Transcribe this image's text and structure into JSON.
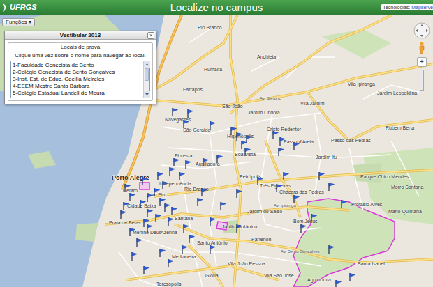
{
  "header": {
    "logo": "UFRGS",
    "title": "Localize no campus",
    "tech_label": "Tecnologias:",
    "tech_link": "Mapserve"
  },
  "functions_button": {
    "label": "Funções",
    "icon": "▾"
  },
  "panel": {
    "title": "Vestibular 2013",
    "close": "×",
    "section": "Locais de prova",
    "hint": "Clique uma vez sobre o nome para navegar ao local.",
    "items": [
      {
        "label": "1-Faculdade Cenecista de Bento",
        "selected": false
      },
      {
        "label": "2-Colégio Cenecista de Bento Gonçalves",
        "selected": false
      },
      {
        "label": "3-Inst. Est. de Educ. Cecília Meireles",
        "selected": false
      },
      {
        "label": "4-EEEM Mestre Santa Bárbara",
        "selected": false
      },
      {
        "label": "5-Colégio Estadual Landell de Moura",
        "selected": false
      }
    ]
  },
  "map": {
    "places": [
      {
        "name": "Rio Branco",
        "kind": "district"
      },
      {
        "name": "Anchieta",
        "kind": "district"
      },
      {
        "name": "Humaitá",
        "kind": "district"
      },
      {
        "name": "Farrapos",
        "kind": "district"
      },
      {
        "name": "São João",
        "kind": "district"
      },
      {
        "name": "Vila Ipiranga",
        "kind": "district"
      },
      {
        "name": "Vila Jardim",
        "kind": "district"
      },
      {
        "name": "Jardim Lindóia",
        "kind": "district"
      },
      {
        "name": "São Geraldo",
        "kind": "district"
      },
      {
        "name": "Navegantes",
        "kind": "district"
      },
      {
        "name": "Cristo Redentor",
        "kind": "district"
      },
      {
        "name": "Higienópolis",
        "kind": "district"
      },
      {
        "name": "Passo d'Areia",
        "kind": "district"
      },
      {
        "name": "Floresta",
        "kind": "district"
      },
      {
        "name": "Auxiliadora",
        "kind": "district"
      },
      {
        "name": "Boa Vista",
        "kind": "district"
      },
      {
        "name": "Petrópolis",
        "kind": "district"
      },
      {
        "name": "Três Figueiras",
        "kind": "district"
      },
      {
        "name": "Chácara das Pedras",
        "kind": "district"
      },
      {
        "name": "Porto Alegre",
        "kind": "city"
      },
      {
        "name": "Centro",
        "kind": "district"
      },
      {
        "name": "Independência",
        "kind": "district"
      },
      {
        "name": "Rio Branco",
        "kind": "district"
      },
      {
        "name": "Bom Fim",
        "kind": "district"
      },
      {
        "name": "Cidade Baixa",
        "kind": "district"
      },
      {
        "name": "Santana",
        "kind": "district"
      },
      {
        "name": "Menino Deus",
        "kind": "district"
      },
      {
        "name": "Azenha",
        "kind": "district"
      },
      {
        "name": "Praia de Belas",
        "kind": "district"
      },
      {
        "name": "Jardim Botânico",
        "kind": "district"
      },
      {
        "name": "Santo Antônio",
        "kind": "district"
      },
      {
        "name": "Partenon",
        "kind": "district"
      },
      {
        "name": "Bom Jesus",
        "kind": "district"
      },
      {
        "name": "Jardim do Salso",
        "kind": "district"
      },
      {
        "name": "Vila João Pessoa",
        "kind": "district"
      },
      {
        "name": "Medianeira",
        "kind": "district"
      },
      {
        "name": "Glória",
        "kind": "district"
      },
      {
        "name": "Teresópolis",
        "kind": "district"
      },
      {
        "name": "Vila São José",
        "kind": "district"
      },
      {
        "name": "Agronomia",
        "kind": "district"
      },
      {
        "name": "Santa Isabel",
        "kind": "district"
      },
      {
        "name": "Passo das Pedras",
        "kind": "district"
      },
      {
        "name": "Rubem Berta",
        "kind": "district"
      },
      {
        "name": "Protásio Alves",
        "kind": "district"
      },
      {
        "name": "Morro Santana",
        "kind": "district"
      },
      {
        "name": "Mário Quintana",
        "kind": "district"
      },
      {
        "name": "Parque Chico Mendes",
        "kind": "district"
      },
      {
        "name": "Jardim Itu",
        "kind": "district"
      },
      {
        "name": "Jardim Leopoldina",
        "kind": "district"
      }
    ],
    "roads": [
      "Av. Sertório",
      "Av. Ipiranga",
      "Av. Bento Gonçalves"
    ],
    "zoom_in": "+"
  }
}
